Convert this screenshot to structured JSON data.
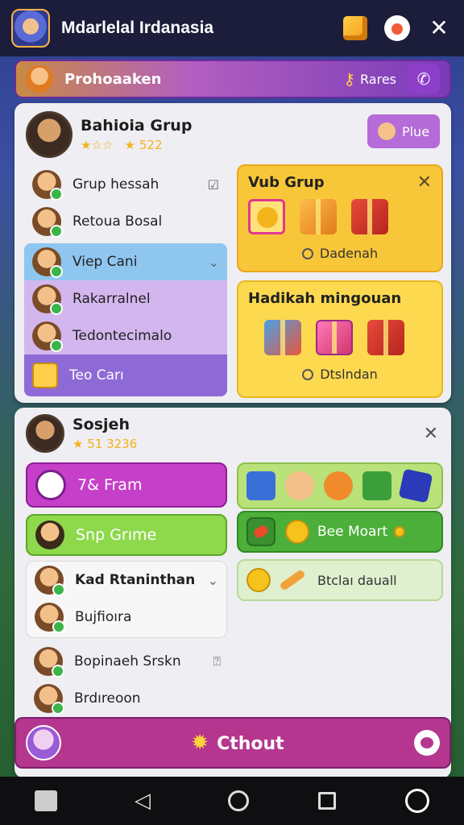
{
  "header": {
    "title": "Mdarlelal Irdanasia",
    "icons": [
      "game-avatar-icon",
      "cube-icon",
      "mascot-icon",
      "close-icon"
    ]
  },
  "banner": {
    "title": "Prohoaaken",
    "link": "Rares",
    "key_icon": "key-icon",
    "action_icon": "phone-icon"
  },
  "group1": {
    "name": "Bahioia Grup",
    "stars": "★☆☆",
    "rating_label": "★ 522",
    "plus_label": "Plue",
    "items": [
      {
        "label": "Grup hessah",
        "side": "☑"
      },
      {
        "label": "Retoua Bosal",
        "side": ""
      },
      {
        "label": "Viep Cani",
        "side": "⌄"
      },
      {
        "label": "Rakarralnel",
        "side": ""
      },
      {
        "label": "Tedontecimalo",
        "side": ""
      },
      {
        "label": "Teo Carı",
        "side": ""
      }
    ],
    "card1": {
      "title": "Vub Grup",
      "footer": "Dadenah"
    },
    "card2": {
      "title": "Hadikah mingouan",
      "footer": "Dtslndan"
    }
  },
  "group2": {
    "name": "Sosjeh",
    "rating_label": "★ 51 3236",
    "buttons": [
      {
        "label": "7& Fram"
      },
      {
        "label": "Snp Grıme"
      }
    ],
    "expand_items": [
      {
        "label": "Kad Rtaninthan",
        "side": "⌄"
      },
      {
        "label": "Bujfioıra",
        "side": ""
      }
    ],
    "list_items": [
      {
        "label": "Bopinaeh Srskn",
        "side": "⍰"
      },
      {
        "label": "Brdıreoon",
        "side": ""
      }
    ],
    "strip2_label": "Bee Moart",
    "strip3_label": "Btclaı dauall"
  },
  "bottom_bar": {
    "label": "Cthout"
  },
  "nav": [
    "home-icon",
    "back-icon",
    "circle-home-icon",
    "recents-icon",
    "power-icon"
  ]
}
